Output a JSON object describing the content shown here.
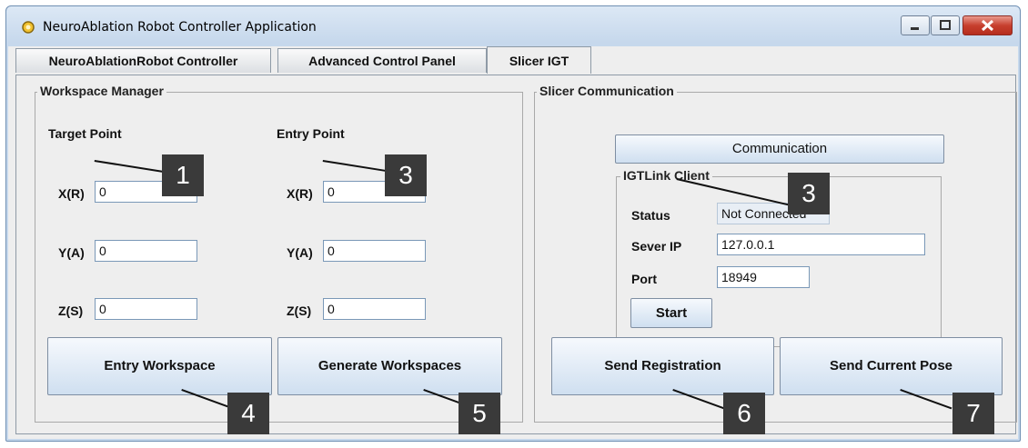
{
  "window": {
    "title": "NeuroAblation Robot Controller Application"
  },
  "tabs": [
    {
      "label": "NeuroAblationRobot Controller"
    },
    {
      "label": "Advanced Control Panel"
    },
    {
      "label": "Slicer IGT"
    }
  ],
  "workspace": {
    "legend": "Workspace Manager",
    "target": {
      "heading": "Target Point",
      "x_label": "X(R)",
      "x": "0",
      "y_label": "Y(A)",
      "y": "0",
      "z_label": "Z(S)",
      "z": "0"
    },
    "entry": {
      "heading": "Entry Point",
      "x_label": "X(R)",
      "x": "0",
      "y_label": "Y(A)",
      "y": "0",
      "z_label": "Z(S)",
      "z": "0"
    },
    "entry_workspace_label": "Entry Workspace",
    "generate_workspaces_label": "Generate Workspaces"
  },
  "slicer": {
    "legend": "Slicer Communication",
    "communication_label": "Communication",
    "client": {
      "legend": "IGTLink Client",
      "status_label": "Status",
      "status_value": "Not Connected",
      "ip_label": "Sever IP",
      "ip_value": "127.0.0.1",
      "port_label": "Port",
      "port_value": "18949",
      "start_label": "Start"
    },
    "send_registration_label": "Send Registration",
    "send_pose_label": "Send Current Pose"
  },
  "callouts": [
    "1",
    "3",
    "3",
    "4",
    "5",
    "6",
    "7"
  ]
}
